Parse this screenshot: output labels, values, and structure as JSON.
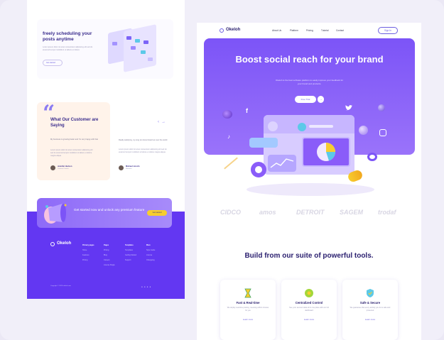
{
  "left": {
    "schedule": {
      "title": "freely scheduling your posts anytime",
      "desc": "Lorem ipsum dolor sit amet consectetur adipiscing elit sed do eiusmod tempor incididunt ut labore et dolore",
      "button": "Get started"
    },
    "testimonials": {
      "heading": "What Our Customer are Saying",
      "t1": {
        "quote": "My business is growing faster and I'm very happy with that",
        "text": "Lorem ipsum dolor sit amet consectetur adipiscing elit sed do eiusmod tempor incididunt ut labore et dolore magna aliqua",
        "name": "Jennifer Hudson",
        "role": "Content Creator"
      },
      "t2": {
        "quote": "Really satisfying, my sing too boost board as over the world",
        "text": "Lorem ipsum dolor sit amet consectetur adipiscing elit sed do eiusmod tempor incididunt ut labore et dolore magna aliqua",
        "name": "Michael Lincoln",
        "role": "Marketer"
      }
    },
    "cta": {
      "text": "Get started now and unlock any premium feature",
      "button": "Get started"
    },
    "footer": {
      "logo": "Okeloh",
      "cols": [
        {
          "head": "Primary pages",
          "items": [
            "Home",
            "Features",
            "Pricing"
          ]
        },
        {
          "head": "Pages",
          "items": [
            "Pricing",
            "Blog",
            "Careers",
            "License Single"
          ]
        },
        {
          "head": "Templates",
          "items": [
            "Templates",
            "Getting Started",
            "Support"
          ]
        },
        {
          "head": "More",
          "items": [
            "Style Guide",
            "License",
            "Changelog"
          ]
        }
      ],
      "copy": "Copyright © 2023 okeloh.com"
    }
  },
  "right": {
    "logo": "Okeloh",
    "nav": [
      "About Us",
      "Platform",
      "Pricing",
      "Tutorial",
      "Contact"
    ],
    "signin": "Sign In",
    "hero": {
      "title": "Boost social reach for your brand",
      "desc": "Okeloh is the best software platform to easily improve your feedback for your brand and products.",
      "button": "Free Trial",
      "arrow": "→"
    },
    "brands": [
      "CIDCO",
      "amos",
      "DETROIT",
      "SAGEM",
      "trodaf"
    ],
    "tools_heading": "Build from our suite of powerful tools.",
    "cards": [
      {
        "title": "Fast & Real-time",
        "text": "We deploy real-time posting, meaning within minutes for you",
        "link": "Learn more"
      },
      {
        "title": "Centralized Control",
        "text": "See your account data all in one place with our full dashboard",
        "link": "Learn more"
      },
      {
        "title": "Safe & Secure",
        "text": "We guarantee that every activity you do is safe and protected",
        "link": "Learn more"
      }
    ],
    "colors": {
      "accent": "#6b5de0",
      "hero": "#7c54f7",
      "footer": "#6337f2",
      "cta_button": "#f7cd2e"
    }
  }
}
